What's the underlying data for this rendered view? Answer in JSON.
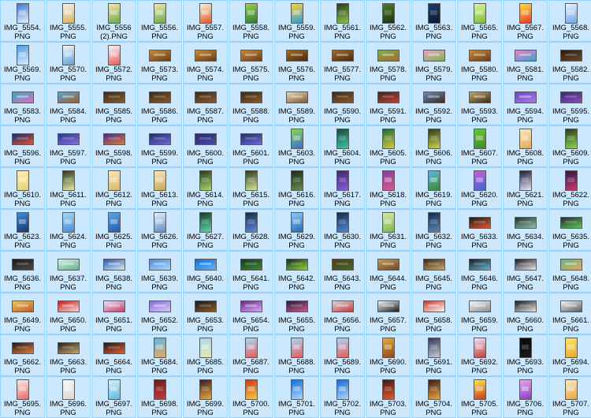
{
  "files": [
    {
      "line1": "IMG_5554.",
      "line2": "PNG",
      "orientation": "portrait",
      "c1": "#3a7bd5",
      "c2": "#e8f0ff"
    },
    {
      "line1": "IMG_5555.",
      "line2": "PNG",
      "orientation": "portrait",
      "c1": "#f2f2f2",
      "c2": "#d9b25a"
    },
    {
      "line1": "IMG_5556",
      "line2": "(2).PNG",
      "orientation": "portrait",
      "c1": "#f3e7b0",
      "c2": "#6ca94b"
    },
    {
      "line1": "IMG_5556.",
      "line2": "PNG",
      "orientation": "portrait",
      "c1": "#f3e7b0",
      "c2": "#6ca94b"
    },
    {
      "line1": "IMG_5557.",
      "line2": "PNG",
      "orientation": "portrait",
      "c1": "#eef6e0",
      "c2": "#e9562a"
    },
    {
      "line1": "IMG_5558.",
      "line2": "PNG",
      "orientation": "portrait",
      "c1": "#9bd34a",
      "c2": "#2c7a3a"
    },
    {
      "line1": "IMG_5559.",
      "line2": "PNG",
      "orientation": "portrait",
      "c1": "#ffd23a",
      "c2": "#2f9bd8"
    },
    {
      "line1": "IMG_5561.",
      "line2": "PNG",
      "orientation": "portrait",
      "c1": "#2b3b1e",
      "c2": "#8bc34a",
      "dark": true
    },
    {
      "line1": "IMG_5562.",
      "line2": "PNG",
      "orientation": "portrait",
      "c1": "#4e7d2a",
      "c2": "#1b3311",
      "dark": true
    },
    {
      "line1": "IMG_5563.",
      "line2": "PNG",
      "orientation": "portrait",
      "c1": "#1d3b6b",
      "c2": "#0c1a30",
      "dark": true
    },
    {
      "line1": "IMG_5565.",
      "line2": "PNG",
      "orientation": "portrait",
      "c1": "#dff3a0",
      "c2": "#7cbf35"
    },
    {
      "line1": "IMG_5567.",
      "line2": "PNG",
      "orientation": "portrait",
      "c1": "#ffde3a",
      "c2": "#e53b2a"
    },
    {
      "line1": "IMG_5568.",
      "line2": "PNG",
      "orientation": "portrait",
      "c1": "#e8f2ff",
      "c2": "#6fa8e8"
    },
    {
      "line1": "IMG_5569.",
      "line2": "PNG",
      "orientation": "portrait",
      "c1": "#4e9be8",
      "c2": "#d9ecff"
    },
    {
      "line1": "IMG_5570.",
      "line2": "PNG",
      "orientation": "portrait",
      "c1": "#f7f7f7",
      "c2": "#5aa0e0"
    },
    {
      "line1": "IMG_5572.",
      "line2": "PNG",
      "orientation": "portrait",
      "c1": "#f7f7f7",
      "c2": "#e85a5a"
    },
    {
      "line1": "IMG_5573.",
      "line2": "PNG",
      "orientation": "landscape",
      "c1": "#c98b3a",
      "c2": "#6a3d14"
    },
    {
      "line1": "IMG_5574.",
      "line2": "PNG",
      "orientation": "landscape",
      "c1": "#c98b3a",
      "c2": "#6a3d14"
    },
    {
      "line1": "IMG_5575.",
      "line2": "PNG",
      "orientation": "landscape",
      "c1": "#c98b3a",
      "c2": "#6a3d14"
    },
    {
      "line1": "IMG_5576.",
      "line2": "PNG",
      "orientation": "landscape",
      "c1": "#a36a2a",
      "c2": "#4a2a10"
    },
    {
      "line1": "IMG_5577.",
      "line2": "PNG",
      "orientation": "landscape",
      "c1": "#a36a2a",
      "c2": "#4a2a10"
    },
    {
      "line1": "IMG_5578.",
      "line2": "PNG",
      "orientation": "landscape",
      "c1": "#7fb04a",
      "c2": "#a36a2a"
    },
    {
      "line1": "IMG_5579.",
      "line2": "PNG",
      "orientation": "landscape",
      "c1": "#e8a7c8",
      "c2": "#7fb04a"
    },
    {
      "line1": "IMG_5580.",
      "line2": "PNG",
      "orientation": "landscape",
      "c1": "#c98b3a",
      "c2": "#6a3d14"
    },
    {
      "line1": "IMG_5581.",
      "line2": "PNG",
      "orientation": "landscape",
      "c1": "#f080c0",
      "c2": "#3aa0d8"
    },
    {
      "line1": "IMG_5582.",
      "line2": "PNG",
      "orientation": "landscape",
      "c1": "#2a1a0e",
      "c2": "#6a4a2a",
      "dark": true
    },
    {
      "line1": "IMG_5583.",
      "line2": "PNG",
      "orientation": "landscape",
      "c1": "#3aa8b8",
      "c2": "#d870c8"
    },
    {
      "line1": "IMG_5584.",
      "line2": "PNG",
      "orientation": "landscape",
      "c1": "#5aa8d8",
      "c2": "#a05a2a"
    },
    {
      "line1": "IMG_5585.",
      "line2": "PNG",
      "orientation": "landscape",
      "c1": "#3a2a1a",
      "c2": "#8a5a2a",
      "dark": true
    },
    {
      "line1": "IMG_5586.",
      "line2": "PNG",
      "orientation": "landscape",
      "c1": "#3a2a1a",
      "c2": "#8a5a2a",
      "dark": true
    },
    {
      "line1": "IMG_5587.",
      "line2": "PNG",
      "orientation": "landscape",
      "c1": "#3a2a1a",
      "c2": "#8a5a2a",
      "dark": true
    },
    {
      "line1": "IMG_5588.",
      "line2": "PNG",
      "orientation": "landscape",
      "c1": "#3a2a1a",
      "c2": "#8a5a2a",
      "dark": true
    },
    {
      "line1": "IMG_5589.",
      "line2": "PNG",
      "orientation": "landscape",
      "c1": "#e8d8b8",
      "c2": "#7a5a3a"
    },
    {
      "line1": "IMG_5590.",
      "line2": "PNG",
      "orientation": "landscape",
      "c1": "#3a2a1a",
      "c2": "#8a5a2a",
      "dark": true
    },
    {
      "line1": "IMG_5591.",
      "line2": "PNG",
      "orientation": "landscape",
      "c1": "#3a2a1a",
      "c2": "#c83a3a",
      "dark": true
    },
    {
      "line1": "IMG_5592.",
      "line2": "PNG",
      "orientation": "landscape",
      "c1": "#6a8ab8",
      "c2": "#3a2a1a"
    },
    {
      "line1": "IMG_5593.",
      "line2": "PNG",
      "orientation": "landscape",
      "c1": "#c8a86a",
      "c2": "#3a2a1a"
    },
    {
      "line1": "IMG_5594.",
      "line2": "PNG",
      "orientation": "landscape",
      "c1": "#6a4ac8",
      "c2": "#a878e8"
    },
    {
      "line1": "IMG_5595.",
      "line2": "PNG",
      "orientation": "landscape",
      "c1": "#3a2a6a",
      "c2": "#8a4ac8",
      "dark": true
    },
    {
      "line1": "IMG_5596.",
      "line2": "PNG",
      "orientation": "landscape",
      "c1": "#1a2a6a",
      "c2": "#d8583a",
      "dark": true
    },
    {
      "line1": "IMG_5597.",
      "line2": "PNG",
      "orientation": "landscape",
      "c1": "#2a3a8a",
      "c2": "#8a6ad8",
      "dark": true
    },
    {
      "line1": "IMG_5598.",
      "line2": "PNG",
      "orientation": "landscape",
      "c1": "#4a2a8a",
      "c2": "#d87a3a",
      "dark": true
    },
    {
      "line1": "IMG_5599.",
      "line2": "PNG",
      "orientation": "landscape",
      "c1": "#2a2a6a",
      "c2": "#6a6ad8",
      "dark": true
    },
    {
      "line1": "IMG_5600.",
      "line2": "PNG",
      "orientation": "landscape",
      "c1": "#2a2a6a",
      "c2": "#4a4aa8",
      "dark": true
    },
    {
      "line1": "IMG_5601.",
      "line2": "PNG",
      "orientation": "landscape",
      "c1": "#2a2a6a",
      "c2": "#6a6ad8",
      "dark": true
    },
    {
      "line1": "IMG_5603.",
      "line2": "PNG",
      "orientation": "portrait",
      "c1": "#8ad84a",
      "c2": "#3a6ad8"
    },
    {
      "line1": "IMG_5604.",
      "line2": "PNG",
      "orientation": "portrait",
      "c1": "#1a4a3a",
      "c2": "#3ac8a8",
      "dark": true
    },
    {
      "line1": "IMG_5605.",
      "line2": "PNG",
      "orientation": "portrait",
      "c1": "#1a6a3a",
      "c2": "#d8c83a",
      "dark": true
    },
    {
      "line1": "IMG_5606.",
      "line2": "PNG",
      "orientation": "portrait",
      "c1": "#2a3a1a",
      "c2": "#c8d84a",
      "dark": true
    },
    {
      "line1": "IMG_5607.",
      "line2": "PNG",
      "orientation": "portrait",
      "c1": "#6ac83a",
      "c2": "#3a8a2a"
    },
    {
      "line1": "IMG_5608.",
      "line2": "PNG",
      "orientation": "portrait",
      "c1": "#f8e8c8",
      "c2": "#e8a84a"
    },
    {
      "line1": "IMG_5609.",
      "line2": "PNG",
      "orientation": "portrait",
      "c1": "#2a3a1a",
      "c2": "#8ad84a",
      "dark": true
    },
    {
      "line1": "IMG_5610.",
      "line2": "PNG",
      "orientation": "portrait",
      "c1": "#fff0b0",
      "c2": "#e8d078"
    },
    {
      "line1": "IMG_5611.",
      "line2": "PNG",
      "orientation": "portrait",
      "c1": "#2a3a1a",
      "c2": "#e8e8a8",
      "dark": true
    },
    {
      "line1": "IMG_5612.",
      "line2": "PNG",
      "orientation": "portrait",
      "c1": "#f8e8b8",
      "c2": "#d8b868"
    },
    {
      "line1": "IMG_5613.",
      "line2": "PNG",
      "orientation": "portrait",
      "c1": "#f8e8b8",
      "c2": "#c8a858"
    },
    {
      "line1": "IMG_5614.",
      "line2": "PNG",
      "orientation": "portrait",
      "c1": "#2a3a1a",
      "c2": "#a8d868",
      "dark": true
    },
    {
      "line1": "IMG_5615.",
      "line2": "PNG",
      "orientation": "portrait",
      "c1": "#2a3a1a",
      "c2": "#d8e898",
      "dark": true
    },
    {
      "line1": "IMG_5616.",
      "line2": "PNG",
      "orientation": "portrait",
      "c1": "#1a2a1a",
      "c2": "#6a8a4a",
      "dark": true
    },
    {
      "line1": "IMG_5617.",
      "line2": "PNG",
      "orientation": "portrait",
      "c1": "#3a2a6a",
      "c2": "#8a5ad8",
      "dark": true
    },
    {
      "line1": "IMG_5618.",
      "line2": "PNG",
      "orientation": "portrait",
      "c1": "#8a3aa8",
      "c2": "#d85a8a"
    },
    {
      "line1": "IMG_5619.",
      "line2": "PNG",
      "orientation": "portrait",
      "c1": "#5ab8e8",
      "c2": "#3a8a2a"
    },
    {
      "line1": "IMG_5620.",
      "line2": "PNG",
      "orientation": "portrait",
      "c1": "#c85ad8",
      "c2": "#3a6ad8"
    },
    {
      "line1": "IMG_5621.",
      "line2": "PNG",
      "orientation": "portrait",
      "c1": "#1a1a3a",
      "c2": "#e8e8f8",
      "dark": true
    },
    {
      "line1": "IMG_5622.",
      "line2": "PNG",
      "orientation": "portrait",
      "c1": "#2a1a4a",
      "c2": "#c83a6a",
      "dark": true
    },
    {
      "line1": "IMG_5623.",
      "line2": "PNG",
      "orientation": "portrait",
      "c1": "#3a8ad8",
      "c2": "#1a3a6a"
    },
    {
      "line1": "IMG_5624.",
      "line2": "PNG",
      "orientation": "portrait",
      "c1": "#a8d8f8",
      "c2": "#4a8ad8"
    },
    {
      "line1": "IMG_5625.",
      "line2": "PNG",
      "orientation": "portrait",
      "c1": "#5aa8e8",
      "c2": "#2a5aa8"
    },
    {
      "line1": "IMG_5626.",
      "line2": "PNG",
      "orientation": "portrait",
      "c1": "#e8f0f8",
      "c2": "#5a8ac8"
    },
    {
      "line1": "IMG_5627.",
      "line2": "PNG",
      "orientation": "portrait",
      "c1": "#1a3a2a",
      "c2": "#5ad8a8",
      "dark": true
    },
    {
      "line1": "IMG_5628.",
      "line2": "PNG",
      "orientation": "portrait",
      "c1": "#1a2a4a",
      "c2": "#5a8ad8",
      "dark": true
    },
    {
      "line1": "IMG_5629.",
      "line2": "PNG",
      "orientation": "portrait",
      "c1": "#8ac8f8",
      "c2": "#2a6ab8"
    },
    {
      "line1": "IMG_5630.",
      "line2": "PNG",
      "orientation": "portrait",
      "c1": "#1a2a4a",
      "c2": "#4a8ad8",
      "dark": true
    },
    {
      "line1": "IMG_5631.",
      "line2": "PNG",
      "orientation": "portrait",
      "c1": "#d8e8a8",
      "c2": "#7ab84a"
    },
    {
      "line1": "IMG_5632.",
      "line2": "PNG",
      "orientation": "portrait",
      "c1": "#1a2a4a",
      "c2": "#5a8ab8",
      "dark": true
    },
    {
      "line1": "IMG_5633.",
      "line2": "PNG",
      "orientation": "landscape",
      "c1": "#1a1a1a",
      "c2": "#e85a2a",
      "dark": true
    },
    {
      "line1": "IMG_5634.",
      "line2": "PNG",
      "orientation": "landscape",
      "c1": "#2a2a2a",
      "c2": "#8ac8a8",
      "dark": true
    },
    {
      "line1": "IMG_5635.",
      "line2": "PNG",
      "orientation": "landscape",
      "c1": "#2a2a2a",
      "c2": "#5ac85a",
      "dark": true
    },
    {
      "line1": "IMG_5636.",
      "line2": "PNG",
      "orientation": "landscape",
      "c1": "#1a1a1a",
      "c2": "#4a4a4a",
      "dark": true
    },
    {
      "line1": "IMG_5637.",
      "line2": "PNG",
      "orientation": "landscape",
      "c1": "#d8f0e8",
      "c2": "#5ab88a"
    },
    {
      "line1": "IMG_5638.",
      "line2": "PNG",
      "orientation": "landscape",
      "c1": "#2a5aa8",
      "c2": "#d8e8f8"
    },
    {
      "line1": "IMG_5639.",
      "line2": "PNG",
      "orientation": "landscape",
      "c1": "#4a8ad8",
      "c2": "#a8d8f8"
    },
    {
      "line1": "IMG_5640.",
      "line2": "PNG",
      "orientation": "landscape",
      "c1": "#1a6ad8",
      "c2": "#5ab8f8"
    },
    {
      "line1": "IMG_5641.",
      "line2": "PNG",
      "orientation": "landscape",
      "c1": "#1a3a1a",
      "c2": "#3a8a3a",
      "dark": true
    },
    {
      "line1": "IMG_5642.",
      "line2": "PNG",
      "orientation": "landscape",
      "c1": "#1a2a1a",
      "c2": "#8ad83a",
      "dark": true
    },
    {
      "line1": "IMG_5643.",
      "line2": "PNG",
      "orientation": "landscape",
      "c1": "#5a3a1a",
      "c2": "#3a6a2a",
      "dark": true
    },
    {
      "line1": "IMG_5644.",
      "line2": "PNG",
      "orientation": "landscape",
      "c1": "#c89a5a",
      "c2": "#6a4a2a"
    },
    {
      "line1": "IMG_5645.",
      "line2": "PNG",
      "orientation": "landscape",
      "c1": "#3a2a1a",
      "c2": "#c8a868",
      "dark": true
    },
    {
      "line1": "IMG_5646.",
      "line2": "PNG",
      "orientation": "landscape",
      "c1": "#1a1a1a",
      "c2": "#5ab8d8",
      "dark": true
    },
    {
      "line1": "IMG_5647.",
      "line2": "PNG",
      "orientation": "landscape",
      "c1": "#1a1a1a",
      "c2": "#e8e8f8",
      "dark": true
    },
    {
      "line1": "IMG_5648.",
      "line2": "PNG",
      "orientation": "landscape",
      "c1": "#5ab88a",
      "c2": "#e8a85a"
    },
    {
      "line1": "IMG_5649.",
      "line2": "PNG",
      "orientation": "landscape",
      "c1": "#e8c85a",
      "c2": "#c85a2a"
    },
    {
      "line1": "IMG_5650.",
      "line2": "PNG",
      "orientation": "landscape",
      "c1": "#c81a1a",
      "c2": "#f8d8d8"
    },
    {
      "line1": "IMG_5651.",
      "line2": "PNG",
      "orientation": "landscape",
      "c1": "#e8e8f8",
      "c2": "#c83a6a"
    },
    {
      "line1": "IMG_5652.",
      "line2": "PNG",
      "orientation": "landscape",
      "c1": "#8a6ad8",
      "c2": "#d8c8f8"
    },
    {
      "line1": "IMG_5653.",
      "line2": "PNG",
      "orientation": "landscape",
      "c1": "#1a1a1a",
      "c2": "#8a5a2a",
      "dark": true
    },
    {
      "line1": "IMG_5654.",
      "line2": "PNG",
      "orientation": "landscape",
      "c1": "#6a2a8a",
      "c2": "#d8a8f8"
    },
    {
      "line1": "IMG_5655.",
      "line2": "PNG",
      "orientation": "landscape",
      "c1": "#2a1a3a",
      "c2": "#c85a8a",
      "dark": true
    },
    {
      "line1": "IMG_5656.",
      "line2": "PNG",
      "orientation": "landscape",
      "c1": "#d8d8d8",
      "c2": "#c83a3a"
    },
    {
      "line1": "IMG_5657.",
      "line2": "PNG",
      "orientation": "landscape",
      "c1": "#f8f8f8",
      "c2": "#1a1a1a"
    },
    {
      "line1": "IMG_5658.",
      "line2": "PNG",
      "orientation": "landscape",
      "c1": "#c83a2a",
      "c2": "#f8f8f8"
    },
    {
      "line1": "IMG_5659.",
      "line2": "PNG",
      "orientation": "landscape",
      "c1": "#f8f8f8",
      "c2": "#8a8a8a"
    },
    {
      "line1": "IMG_5660.",
      "line2": "PNG",
      "orientation": "landscape",
      "c1": "#1a1a1a",
      "c2": "#e8e8e8",
      "dark": true
    },
    {
      "line1": "IMG_5661.",
      "line2": "PNG",
      "orientation": "landscape",
      "c1": "#f8f8f8",
      "c2": "#5a5a5a"
    },
    {
      "line1": "IMG_5662.",
      "line2": "PNG",
      "orientation": "landscape",
      "c1": "#1a1a1a",
      "c2": "#e87a3a",
      "dark": true
    },
    {
      "line1": "IMG_5663.",
      "line2": "PNG",
      "orientation": "landscape",
      "c1": "#2a1a1a",
      "c2": "#c8a868",
      "dark": true
    },
    {
      "line1": "IMG_5664.",
      "line2": "PNG",
      "orientation": "landscape",
      "c1": "#1a1a1a",
      "c2": "#e85a2a",
      "dark": true
    },
    {
      "line1": "IMG_5684.",
      "line2": "PNG",
      "orientation": "portrait",
      "c1": "#5ab8e8",
      "c2": "#e8a85a"
    },
    {
      "line1": "IMG_5685.",
      "line2": "PNG",
      "orientation": "portrait",
      "c1": "#a8d8f8",
      "c2": "#e8e8a8"
    },
    {
      "line1": "IMG_5687.",
      "line2": "PNG",
      "orientation": "portrait",
      "c1": "#a8d8f8",
      "c2": "#e85a5a"
    },
    {
      "line1": "IMG_5688.",
      "line2": "PNG",
      "orientation": "portrait",
      "c1": "#a8d8f8",
      "c2": "#e85a5a"
    },
    {
      "line1": "IMG_5689.",
      "line2": "PNG",
      "orientation": "portrait",
      "c1": "#a8d8f8",
      "c2": "#e85a5a"
    },
    {
      "line1": "IMG_5690.",
      "line2": "PNG",
      "orientation": "portrait",
      "c1": "#e8a83a",
      "c2": "#8a4a1a"
    },
    {
      "line1": "IMG_5691.",
      "line2": "PNG",
      "orientation": "portrait",
      "c1": "#2a3a5a",
      "c2": "#c8c8d8",
      "dark": true
    },
    {
      "line1": "IMG_5692.",
      "line2": "PNG",
      "orientation": "portrait",
      "c1": "#e8e8f8",
      "c2": "#c83a3a"
    },
    {
      "line1": "IMG_5693.",
      "line2": "PNG",
      "orientation": "portrait",
      "c1": "#0a0a0a",
      "c2": "#1a1a1a",
      "dark": true
    },
    {
      "line1": "IMG_5694.",
      "line2": "PNG",
      "orientation": "portrait",
      "c1": "#f8e85a",
      "c2": "#e8a83a"
    },
    {
      "line1": "IMG_5695.",
      "line2": "PNG",
      "orientation": "portrait",
      "c1": "#f8e8e8",
      "c2": "#e86a6a"
    },
    {
      "line1": "IMG_5696.",
      "line2": "PNG",
      "orientation": "portrait",
      "c1": "#f8f8f8",
      "c2": "#d8d8d8"
    },
    {
      "line1": "IMG_5697.",
      "line2": "PNG",
      "orientation": "portrait",
      "c1": "#d8f0f8",
      "c2": "#5ab8e8"
    },
    {
      "line1": "IMG_5698.",
      "line2": "PNG",
      "orientation": "portrait",
      "c1": "#6a1a1a",
      "c2": "#c83a3a",
      "dark": true
    },
    {
      "line1": "IMG_5699.",
      "line2": "PNG",
      "orientation": "portrait",
      "c1": "#3a1a1a",
      "c2": "#e8a83a",
      "dark": true
    },
    {
      "line1": "IMG_5700.",
      "line2": "PNG",
      "orientation": "portrait",
      "c1": "#c83a1a",
      "c2": "#f8c83a"
    },
    {
      "line1": "IMG_5701.",
      "line2": "PNG",
      "orientation": "portrait",
      "c1": "#1a6ad8",
      "c2": "#a8d8f8"
    },
    {
      "line1": "IMG_5702.",
      "line2": "PNG",
      "orientation": "portrait",
      "c1": "#1a6ad8",
      "c2": "#a8d8f8"
    },
    {
      "line1": "IMG_5703.",
      "line2": "PNG",
      "orientation": "portrait",
      "c1": "#3a1a1a",
      "c2": "#e85a2a",
      "dark": true
    },
    {
      "line1": "IMG_5704.",
      "line2": "PNG",
      "orientation": "portrait",
      "c1": "#3a1a1a",
      "c2": "#e8a83a",
      "dark": true
    },
    {
      "line1": "IMG_5705.",
      "line2": "PNG",
      "orientation": "portrait",
      "c1": "#f8e85a",
      "c2": "#c83a1a"
    },
    {
      "line1": "IMG_5706.",
      "line2": "PNG",
      "orientation": "portrait",
      "c1": "#e8a8e8",
      "c2": "#8a3ac8"
    },
    {
      "line1": "IMG_5707.",
      "line2": "PNG",
      "orientation": "portrait",
      "c1": "#f8e8c8",
      "c2": "#e8a83a"
    }
  ]
}
